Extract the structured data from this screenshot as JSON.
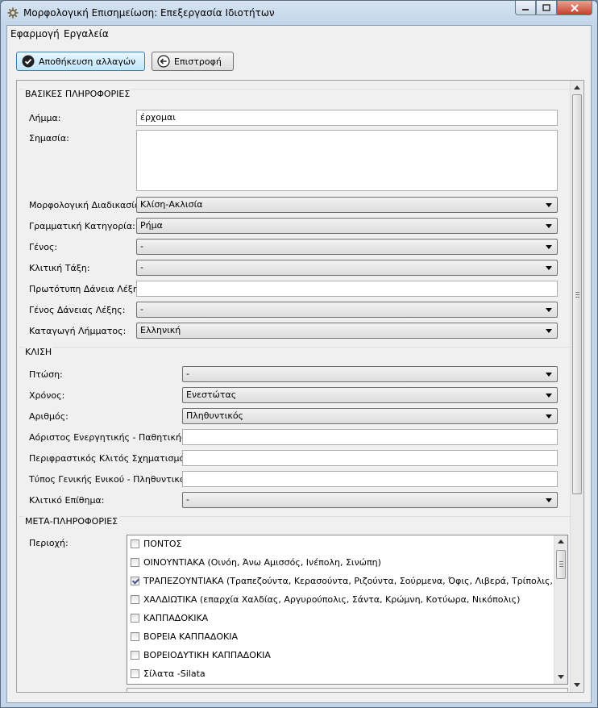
{
  "window": {
    "title": "Μορφολογική Επισημείωση: Επεξεργασία Ιδιοτήτων",
    "icon": "gear-icon"
  },
  "menu": [
    "Εφαρμογή",
    "Εργαλεία"
  ],
  "toolbar": {
    "save_label": "Αποθήκευση αλλαγών",
    "back_label": "Επιστροφή"
  },
  "basic": {
    "title": "ΒΑΣΙΚΕΣ ΠΛΗΡΟΦΟΡΙΕΣ",
    "lemma_label": "Λήμμα:",
    "lemma_value": "έρχομαι",
    "meaning_label": "Σημασία:",
    "morph_label": "Μορφολογική Διαδικασία:",
    "morph_value": "Κλίση-Ακλισία",
    "gram_label": "Γραμματική Κατηγορία:",
    "gram_value": "Ρήμα",
    "gender_label": "Γένος:",
    "gender_value": "-",
    "class_label": "Κλιτική Τάξη:",
    "class_value": "-",
    "orig_label": "Πρωτότυπη Δάνεια Λέξη:",
    "orig_value": "",
    "loan_gender_label": "Γένος Δάνειας Λέξης:",
    "loan_gender_value": "-",
    "origin_label": "Καταγωγή Λήμματος:",
    "origin_value": "Ελληνική"
  },
  "inflection": {
    "title": "ΚΛΙΣΗ",
    "case_label": "Πτώση:",
    "case_value": "-",
    "tense_label": "Χρόνος:",
    "tense_value": "Ενεστώτας",
    "number_label": "Αριθμός:",
    "number_value": "Πληθυντικός",
    "aorist_label": "Αόριστος Ενεργητικής - Παθητικής:",
    "periphrastic_label": "Περιφραστικός Κλιτός Σχηματισμός:",
    "genitive_label": "Τύπος Γενικής Ενικού - Πληθυντικού:",
    "suffix_label": "Κλιτικό Επίθημα:",
    "suffix_value": "-"
  },
  "meta": {
    "title": "ΜΕΤΑ-ΠΛΗΡΟΦΟΡΙΕΣ",
    "region_label": "Περιοχή:",
    "regions": [
      {
        "label": "ΠΟΝΤΟΣ",
        "checked": false
      },
      {
        "label": "ΟΙΝΟΥΝΤΙΑΚΑ (Οινόη, Άνω Αμισσός, Ινέπολη, Σινώπη)",
        "checked": false
      },
      {
        "label": "ΤΡΑΠΕΖΟΥΝΤΙΑΚΑ (Τραπεζούντα, Κερασούντα, Ριζούντα, Σούρμενα, Όφις, Λιβερά, Τρίπολις, Ματσούκα)",
        "checked": true
      },
      {
        "label": "ΧΑΛΔΙΩΤΙΚΑ (επαρχία Χαλδίας, Αργυρούπολις, Σάντα, Κρώμνη, Κοτύωρα, Νικόπολις)",
        "checked": false
      },
      {
        "label": "ΚΑΠΠΑΔΟΚΙΚΑ",
        "checked": false
      },
      {
        "label": "ΒΟΡΕΙΑ ΚΑΠΠΑΔΟΚΙΑ",
        "checked": false
      },
      {
        "label": "ΒΟΡΕΙΟΔΥΤΙΚΗ ΚΑΠΠΑΔΟΚΙΑ",
        "checked": false
      },
      {
        "label": "Σίλατα -Silata",
        "checked": false
      }
    ]
  }
}
